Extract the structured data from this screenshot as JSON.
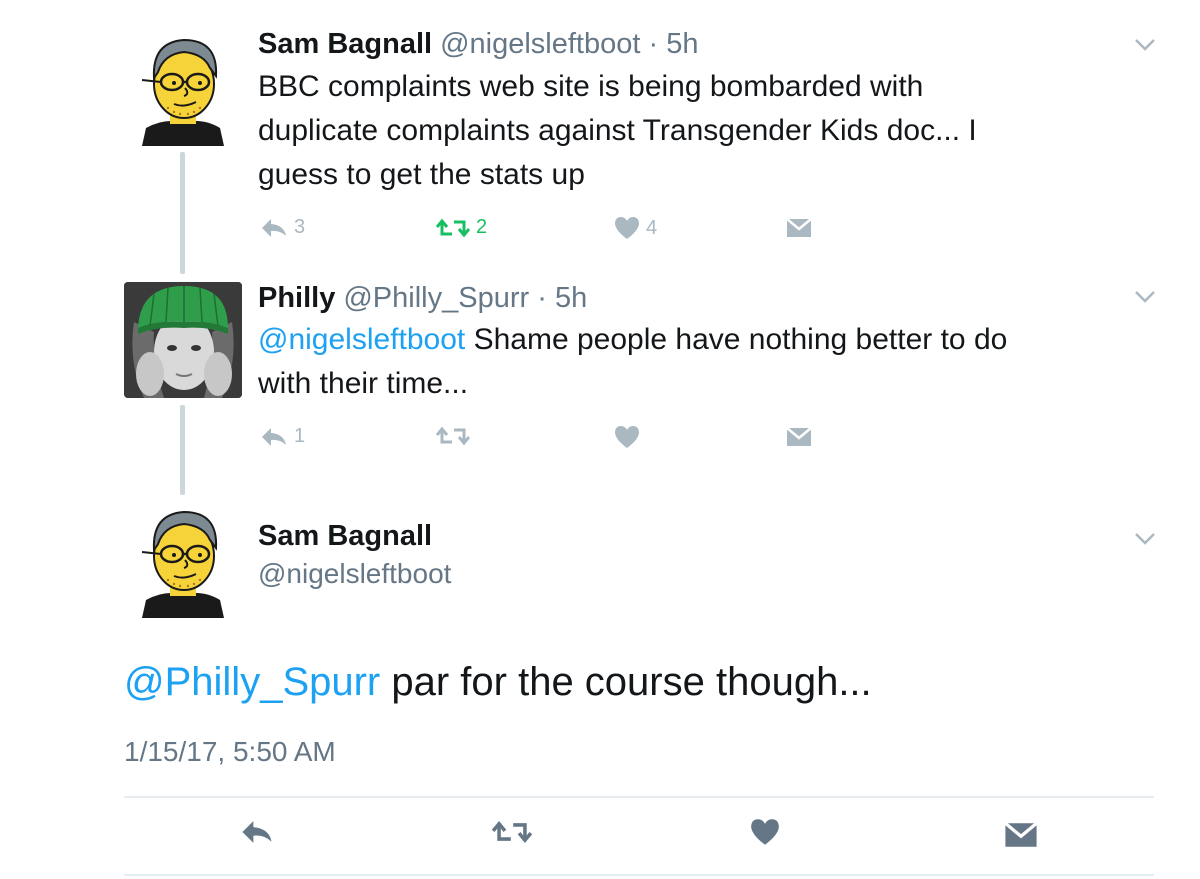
{
  "tweets": [
    {
      "name": "Sam Bagnall",
      "handle": "@nigelsleftboot",
      "separator": "·",
      "time": "5h",
      "text_lines": [
        "BBC complaints web site is being bombarded with",
        "duplicate complaints against Transgender Kids doc... I",
        "guess to get the stats up"
      ],
      "reply_count": "3",
      "retweet_count": "2",
      "like_count": "4",
      "retweeted": true
    },
    {
      "name": "Philly",
      "handle": "@Philly_Spurr",
      "separator": "·",
      "time": "5h",
      "mention": "@nigelsleftboot",
      "text_line1": " Shame people have nothing better to do",
      "text_line2": "with their time...",
      "reply_count": "1"
    }
  ],
  "focused_tweet": {
    "name": "Sam Bagnall",
    "handle": "@nigelsleftboot",
    "mention": "@Philly_Spurr",
    "text": " par for the course though...",
    "timestamp": "1/15/17, 5:50 AM"
  },
  "icons": {
    "reply": "reply-icon",
    "retweet": "retweet-icon",
    "like": "heart-icon",
    "dm": "envelope-icon",
    "menu": "chevron-down-icon"
  },
  "colors": {
    "mention": "#1da1f2",
    "retweet_active": "#17bf63",
    "icon_inactive": "#aab8c2",
    "big_icon": "#657786",
    "thread_line": "#ccd6dd"
  }
}
